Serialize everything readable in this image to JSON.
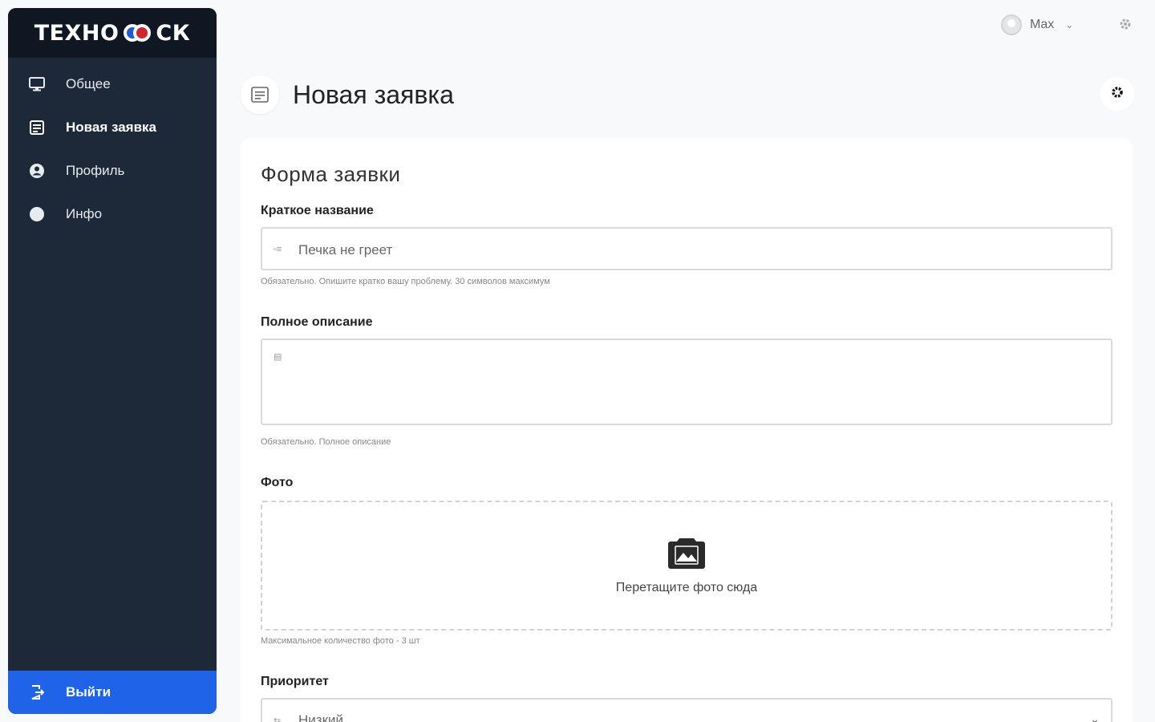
{
  "sidebar": {
    "logo_left": "ТЕХНО",
    "logo_right": "СК",
    "items": [
      {
        "label": "Общее"
      },
      {
        "label": "Новая заявка"
      },
      {
        "label": "Профиль"
      },
      {
        "label": "Инфо"
      }
    ],
    "logout_label": "Выйти"
  },
  "topbar": {
    "user_name": "Max"
  },
  "header": {
    "title": "Новая заявка"
  },
  "form": {
    "title": "Форма заявки",
    "short_name": {
      "label": "Краткое название",
      "value": "Печка не греет",
      "hint": "Обязательно. Опишите кратко вашу проблему. 30 символов максимум"
    },
    "full_description": {
      "label": "Полное описание",
      "value": "",
      "hint": "Обязательно. Полное описание"
    },
    "photo": {
      "label": "Фото",
      "drop_text": "Перетащите фото сюда",
      "hint": "Максимальное количество фото - 3 шт"
    },
    "priority": {
      "label": "Приоритет",
      "value": "Низкий"
    }
  },
  "colors": {
    "sidebar_bg": "#1d2938",
    "logo_bg": "#0f1722",
    "accent": "#1f63e8"
  }
}
